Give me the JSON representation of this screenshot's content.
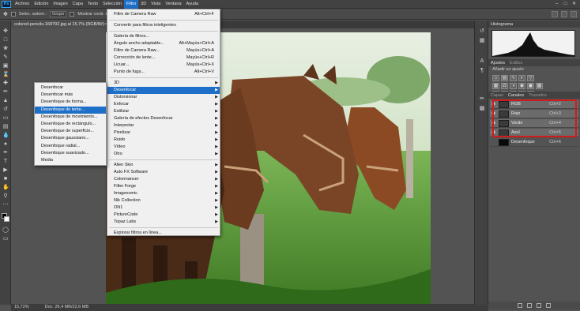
{
  "menubar": {
    "logo": "Ps",
    "items": [
      "Archivo",
      "Edición",
      "Imagen",
      "Capa",
      "Texto",
      "Selección",
      "Filtro",
      "3D",
      "Vista",
      "Ventana",
      "Ayuda"
    ],
    "active_index": 6
  },
  "options_bar": {
    "auto_select_label": "Selec. autom.:",
    "group_value": "Grupo",
    "transform_label": "Mostrar contr. trans"
  },
  "document_tab": {
    "title": "colored-pencils-168792.jpg al 15,7% (RGB/8#)",
    "close": "×"
  },
  "status_bar": {
    "zoom": "15,72%",
    "doc": "Doc: 26,4 MB/22,6 MB"
  },
  "filter_menu": {
    "items": [
      {
        "label": "Filtro de Camera Raw",
        "shortcut": "Alt+Ctrl+F"
      },
      {
        "separator": true
      },
      {
        "label": "Convertir para filtros inteligentes"
      },
      {
        "separator": true
      },
      {
        "label": "Galería de filtros..."
      },
      {
        "label": "Ángulo ancho adaptable...",
        "shortcut": "Alt+Mayús+Ctrl+A"
      },
      {
        "label": "Filtro de Camera Raw...",
        "shortcut": "Mayús+Ctrl+A"
      },
      {
        "label": "Corrección de lente...",
        "shortcut": "Mayús+Ctrl+R"
      },
      {
        "label": "Licuar...",
        "shortcut": "Mayús+Ctrl+X"
      },
      {
        "label": "Punto de fuga...",
        "shortcut": "Alt+Ctrl+V"
      },
      {
        "separator": true
      },
      {
        "label": "3D",
        "submenu": true
      },
      {
        "label": "Desenfocar",
        "submenu": true,
        "highlighted": true
      },
      {
        "label": "Distorsionar",
        "submenu": true
      },
      {
        "label": "Enfocar",
        "submenu": true
      },
      {
        "label": "Estilizar",
        "submenu": true
      },
      {
        "label": "Galería de efectos Desenfocar",
        "submenu": true
      },
      {
        "label": "Interpretar",
        "submenu": true
      },
      {
        "label": "Pixelizar",
        "submenu": true
      },
      {
        "label": "Ruido",
        "submenu": true
      },
      {
        "label": "Vídeo",
        "submenu": true
      },
      {
        "label": "Otro",
        "submenu": true
      },
      {
        "separator": true
      },
      {
        "label": "Alien Skin",
        "submenu": true
      },
      {
        "label": "Auto FX Software",
        "submenu": true
      },
      {
        "label": "Colormancer",
        "submenu": true
      },
      {
        "label": "Filter Forge",
        "submenu": true
      },
      {
        "label": "Imagenomic",
        "submenu": true
      },
      {
        "label": "Nik Collection",
        "submenu": true
      },
      {
        "label": "ON1",
        "submenu": true
      },
      {
        "label": "PictureCode",
        "submenu": true
      },
      {
        "label": "Topaz Labs",
        "submenu": true
      },
      {
        "separator": true
      },
      {
        "label": "Explorar filtros en línea..."
      }
    ]
  },
  "blur_submenu": {
    "items": [
      {
        "label": "Desenfocar"
      },
      {
        "label": "Desenfocar más"
      },
      {
        "label": "Desenfoque de forma..."
      },
      {
        "label": "Desenfoque de lente...",
        "highlighted": true
      },
      {
        "label": "Desenfoque de movimiento..."
      },
      {
        "label": "Desenfoque de rectángulo..."
      },
      {
        "label": "Desenfoque de superficie..."
      },
      {
        "label": "Desenfoque gaussiano..."
      },
      {
        "label": "Desenfoque radial..."
      },
      {
        "label": "Desenfoque suavizado..."
      },
      {
        "label": "Media"
      }
    ]
  },
  "panels": {
    "histogram_title": "Histograma",
    "adjust_tabs": [
      "Ajustes",
      "Estilos"
    ],
    "adjust_hint": "Añadir un ajuste",
    "channel_tabs": [
      "Capas",
      "Canales",
      "Trazados"
    ],
    "channels": [
      {
        "name": "RGB",
        "shortcut": "Ctrl+2"
      },
      {
        "name": "Rojo",
        "shortcut": "Ctrl+3"
      },
      {
        "name": "Verde",
        "shortcut": "Ctrl+4"
      },
      {
        "name": "Azul",
        "shortcut": "Ctrl+5"
      },
      {
        "name": "Desenfoque",
        "shortcut": "Ctrl+6"
      }
    ]
  },
  "colors": {
    "menu_highlight": "#1e6fc8",
    "channel_outline": "#d11a1a",
    "app_bg": "#535353"
  }
}
